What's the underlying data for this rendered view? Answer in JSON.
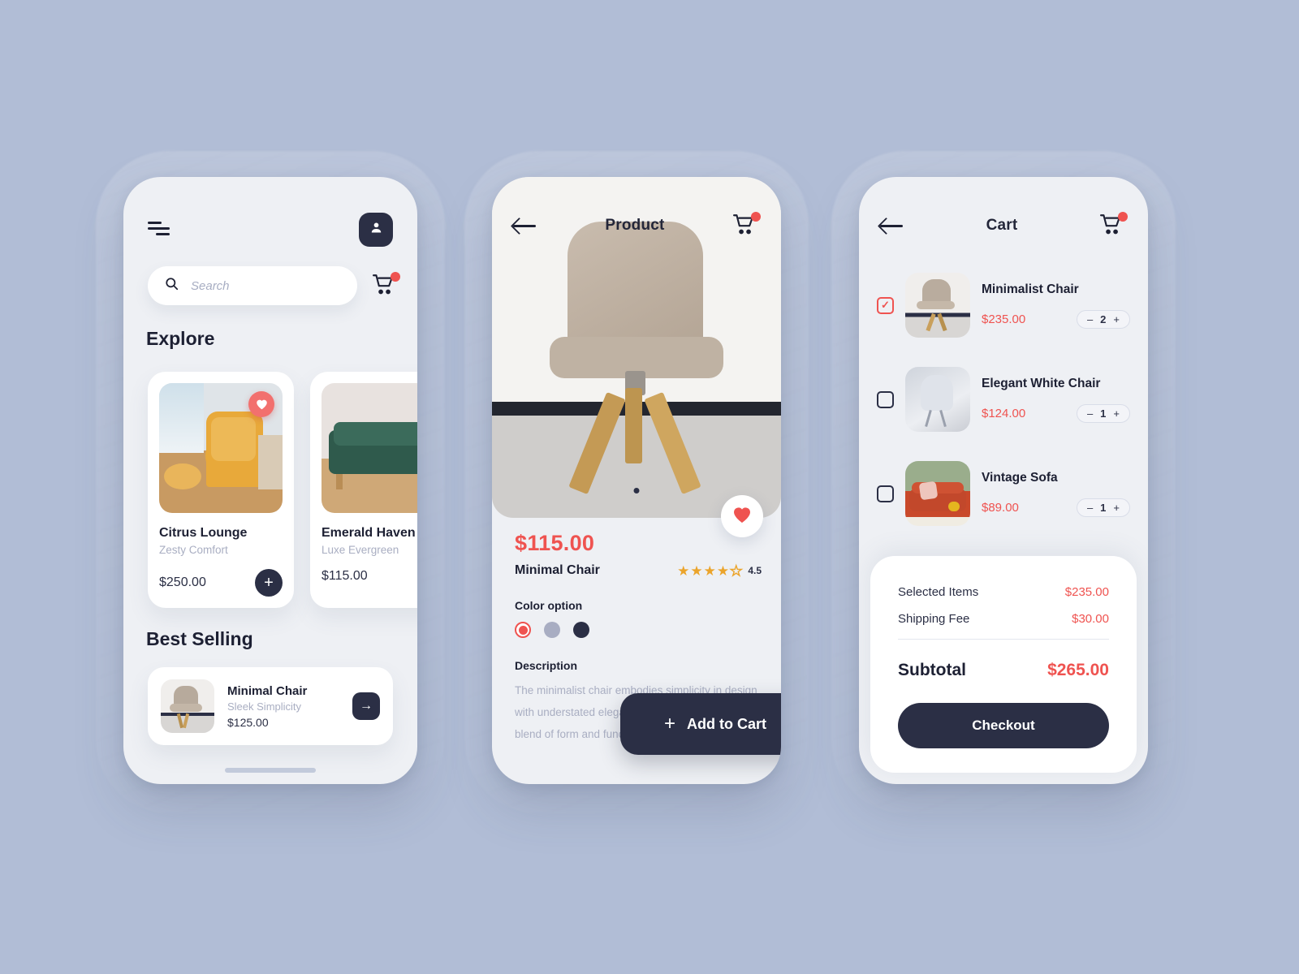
{
  "theme": {
    "background": "#b1bdd6",
    "phone_bg": "#eef0f4",
    "dark": "#2b2f45",
    "accent": "#ef5350",
    "muted": "#a9aec2",
    "star": "#eba42b"
  },
  "screen_home": {
    "menu_icon": "hamburger-icon",
    "profile_icon": "user-icon",
    "search": {
      "placeholder": "Search",
      "icon": "search-icon"
    },
    "cart_icon": "cart-icon",
    "sections": {
      "explore": "Explore",
      "best_selling": "Best Selling"
    },
    "explore_items": [
      {
        "name": "Citrus Lounge",
        "subtitle": "Zesty Comfort",
        "price": "$250.00",
        "favorite": true,
        "image": "yellow-armchair-with-ottoman",
        "add_label": "+"
      },
      {
        "name": "Emerald Haven",
        "subtitle": "Luxe Evergreen",
        "price": "$115.00",
        "favorite": false,
        "image": "green-velvet-sofa",
        "add_label": "+"
      }
    ],
    "best_selling_item": {
      "name": "Minimal Chair",
      "subtitle": "Sleek Simplicity",
      "price": "$125.00",
      "image": "beige-swivel-chair",
      "arrow_label": "→"
    }
  },
  "screen_product": {
    "title": "Product",
    "back_icon": "back-arrow-icon",
    "cart_icon": "cart-icon",
    "hero_image": "beige-swivel-chair-on-rug",
    "favorite_icon": "heart-icon",
    "price": "$115.00",
    "name": "Minimal Chair",
    "rating": {
      "value": "4.5",
      "filled_stars": 4,
      "total_stars": 5
    },
    "color_option_label": "Color option",
    "color_options": [
      {
        "hex": "#ef5350",
        "selected": true
      },
      {
        "hex": "#a8adc2",
        "selected": false
      },
      {
        "hex": "#2b2f45",
        "selected": false
      }
    ],
    "description_label": "Description",
    "description": "The minimalist chair embodies simplicity in design with understated elegance, offering a tasteful blend of form and function for modern spaces.",
    "add_to_cart_label": "Add to Cart",
    "add_to_cart_icon": "plus-icon"
  },
  "screen_cart": {
    "title": "Cart",
    "back_icon": "back-arrow-icon",
    "cart_icon": "cart-icon",
    "items": [
      {
        "name": "Minimalist Chair",
        "price": "$235.00",
        "qty": "2",
        "selected": true,
        "image": "beige-swivel-chair",
        "minus": "–",
        "plus": "+"
      },
      {
        "name": "Elegant White Chair",
        "price": "$124.00",
        "qty": "1",
        "selected": false,
        "image": "white-eames-chair",
        "minus": "–",
        "plus": "+"
      },
      {
        "name": "Vintage Sofa",
        "price": "$89.00",
        "qty": "1",
        "selected": false,
        "image": "orange-vintage-sofa",
        "minus": "–",
        "plus": "+"
      }
    ],
    "summary": {
      "selected_items_label": "Selected Items",
      "selected_items_value": "$235.00",
      "shipping_label": "Shipping Fee",
      "shipping_value": "$30.00",
      "subtotal_label": "Subtotal",
      "subtotal_value": "$265.00",
      "checkout_label": "Checkout"
    }
  }
}
